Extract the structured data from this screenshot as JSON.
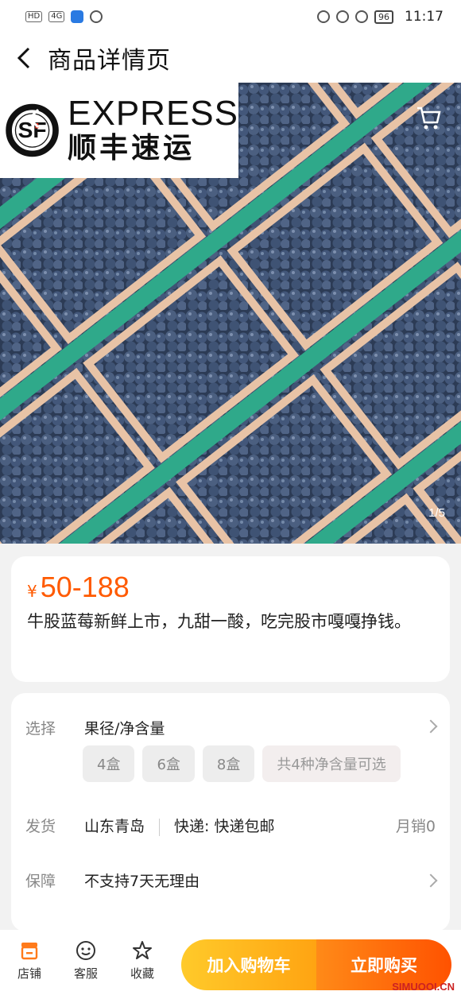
{
  "status_bar": {
    "time": "11:17",
    "battery": "96",
    "badges": [
      "HD",
      "4G"
    ]
  },
  "header": {
    "title": "商品详情页"
  },
  "gallery": {
    "logo_en": "EXPRESS",
    "logo_cn": "顺丰速运",
    "counter": "1/5"
  },
  "product": {
    "currency": "¥",
    "price": "50-188",
    "description": "牛股蓝莓新鲜上市，九甜一酸，吃完股市嘎嘎挣钱。"
  },
  "options": {
    "select_label": "选择",
    "select_value": "果径/净含量",
    "chips": [
      "4盒",
      "6盒",
      "8盒",
      "共4种净含量可选"
    ],
    "ship_label": "发货",
    "ship_origin": "山东青岛",
    "ship_express": "快递: 快递包邮",
    "monthly_sales": "月销0",
    "guarantee_label": "保障",
    "guarantee_value": "不支持7天无理由"
  },
  "bottom_bar": {
    "shop": "店铺",
    "service": "客服",
    "favorite": "收藏",
    "add_to_cart": "加入购物车",
    "buy_now": "立即购买"
  },
  "watermark": "SIMUOOI.CN",
  "colors": {
    "price": "#ff5a00",
    "cart_gradient": [
      "#ffca2a",
      "#ffa412"
    ],
    "buy_gradient": [
      "#ff8a18",
      "#ff5200"
    ]
  }
}
